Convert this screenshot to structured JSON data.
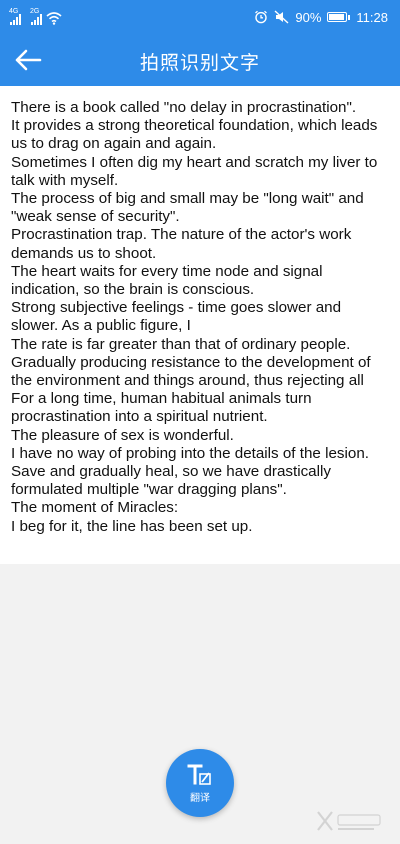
{
  "status_bar": {
    "signal_1_tag": "4G",
    "signal_2_tag": "2G",
    "battery_percent": "90%",
    "battery_level": 0.9,
    "time": "11:28"
  },
  "header": {
    "title": "拍照识别文字"
  },
  "ocr_result": {
    "lines": [
      "There is a book called \"no delay in procrastination\".",
      "It provides a strong theoretical foundation, which leads us to drag on again and again.",
      "Sometimes I often dig my heart and scratch my liver to talk with myself.",
      "The process of big and small may be \"long wait\" and \"weak sense of security\".",
      "Procrastination trap. The nature of the actor's work demands us to shoot.",
      "The heart waits for every time node and signal indication, so the brain is conscious.",
      "Strong subjective feelings - time goes slower and slower. As a public figure, I",
      "The rate is far greater than that of ordinary people.",
      "Gradually producing resistance to the development of the environment and things around, thus rejecting all",
      "For a long time, human habitual animals turn procrastination into a spiritual nutrient.",
      "The pleasure of sex is wonderful.",
      "I have no way of probing into the details of the lesion.",
      "Save and gradually heal, so we have drastically formulated multiple \"war dragging plans\".",
      "The moment of Miracles:",
      "I beg for it, the line has been set up."
    ]
  },
  "fab": {
    "label": "翻译"
  },
  "colors": {
    "accent": "#2e8be8",
    "content_bg": "#ffffff",
    "page_bg": "#f2f2f2",
    "text": "#111111"
  },
  "icons": {
    "back": "arrow-left-icon",
    "translate": "translate-icon",
    "alarm": "alarm-icon",
    "mute": "mute-icon",
    "wifi": "wifi-icon",
    "battery": "battery-icon"
  }
}
